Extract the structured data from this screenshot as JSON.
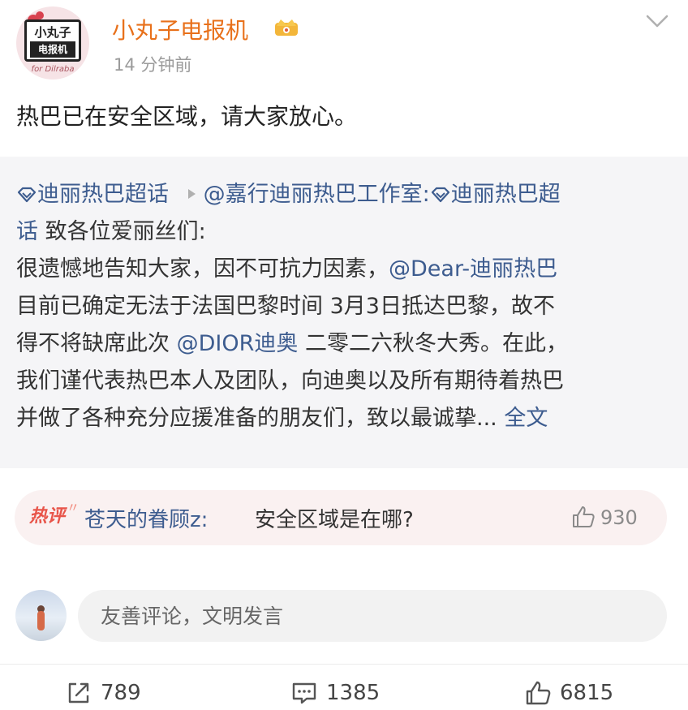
{
  "post": {
    "author": "小丸子电报机",
    "avatar_text_top": "小丸子",
    "avatar_text_bottom": "电报机",
    "avatar_caption": "for Dilraba",
    "time_ago": "14 分钟前",
    "text": "热巴已在安全区域，请大家放心。"
  },
  "repost": {
    "topic_1": "迪丽热巴超话",
    "mention_studio": "@嘉行迪丽热巴工作室:",
    "topic_2_line1": "迪丽热巴超",
    "topic_2_line2": "话",
    "line2_rest": " 致各位爱丽丝们:",
    "line3_a": "很遗憾地告知大家，因不可抗力因素，",
    "mention_dear": "@Dear-迪丽热巴",
    "line4": "目前已确定无法于法国巴黎时间 3月3日抵达巴黎，故不",
    "line5_a": "得不将缺席此次 ",
    "mention_dior": "@DIOR迪奥",
    "line5_b": " 二零二六秋冬大秀。在此，",
    "line6": "我们谨代表热巴本人及团队，向迪奥以及所有期待着热巴",
    "line7": "并做了各种充分应援准备的朋友们，致以最诚挚... ",
    "full_text": "全文"
  },
  "hot_comment": {
    "badge": "热评",
    "user": "苍天的眷顾z:",
    "text": "安全区域是在哪?",
    "likes": "930"
  },
  "comment_box": {
    "placeholder": "友善评论，文明发言"
  },
  "actions": {
    "reposts": "789",
    "comments": "1385",
    "likes": "6815"
  },
  "colors": {
    "author": "#e8701a",
    "link": "#3d5c8f",
    "hot_badge": "#e8554a",
    "repost_bg": "#f5f5f7"
  },
  "icons": {
    "crown": "vip-crown-icon",
    "chevron": "chevron-down-icon",
    "topic": "diamond-topic-icon",
    "share": "share-icon",
    "comment": "comment-icon",
    "like": "thumbs-up-icon"
  }
}
